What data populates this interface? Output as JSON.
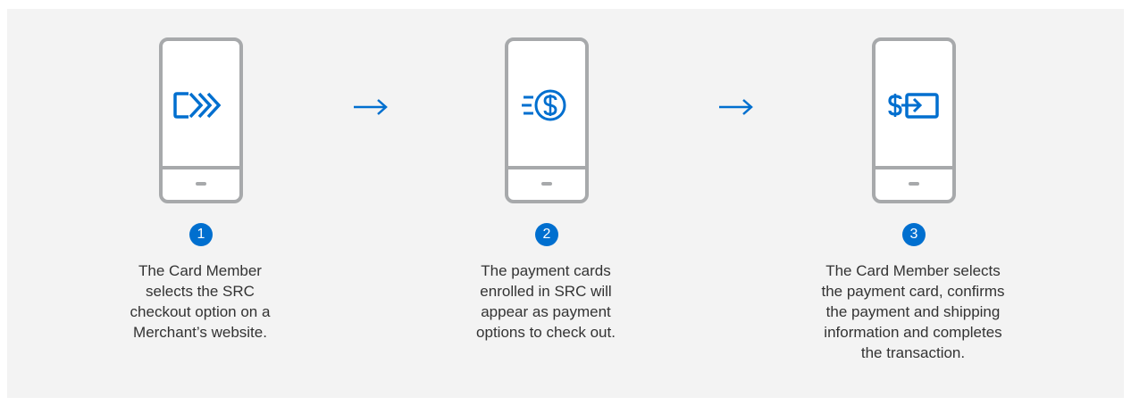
{
  "steps": [
    {
      "number": "1",
      "icon": "card-forward-icon",
      "text": "The Card Member\nselects the SRC\ncheckout option on a\nMerchant’s website."
    },
    {
      "number": "2",
      "icon": "dollar-coin-icon",
      "text": "The payment cards\nenrolled in SRC will\nappear as payment\noptions to check out."
    },
    {
      "number": "3",
      "icon": "dollar-card-transfer-icon",
      "text": "The Card Member selects\nthe payment card, confirms\nthe payment and shipping\ninformation and completes\nthe transaction."
    }
  ],
  "arrows": [
    "arrow-right-icon",
    "arrow-right-icon"
  ],
  "colors": {
    "background": "#f3f3f3",
    "accent": "#006fcf",
    "device_outline": "#a7a9ab",
    "text": "#333333"
  }
}
